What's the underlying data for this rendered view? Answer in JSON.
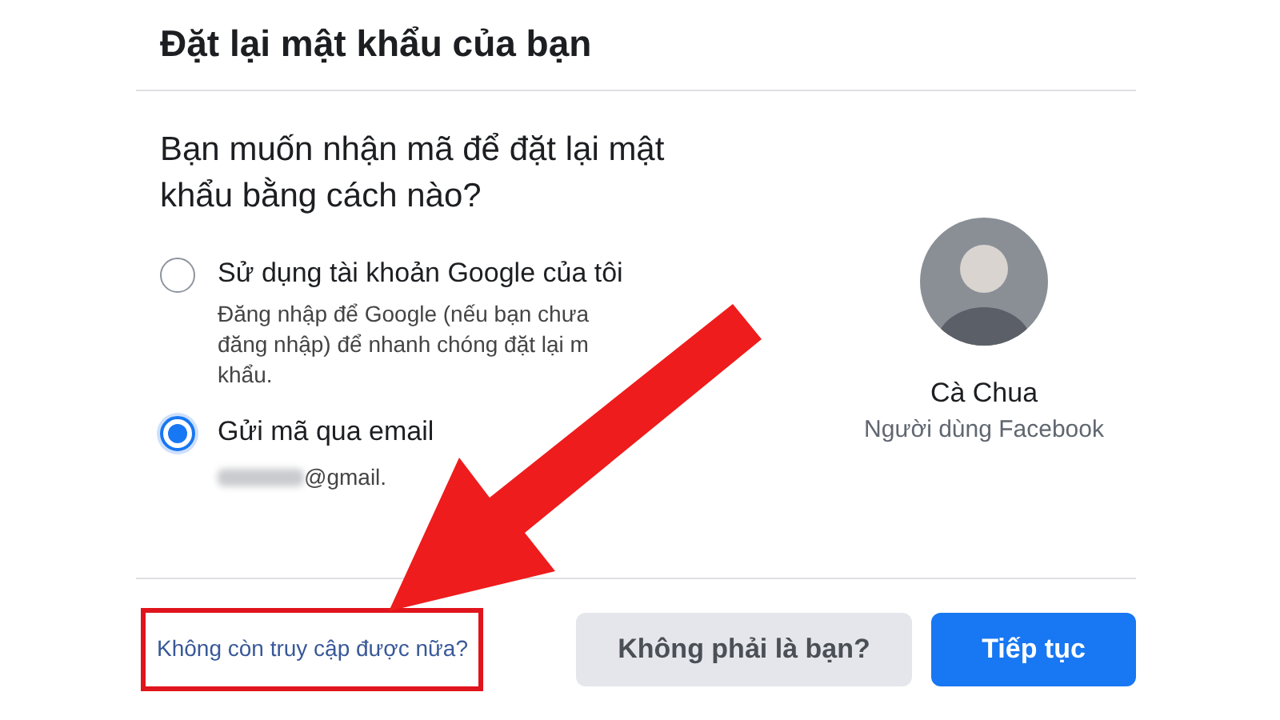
{
  "title": "Đặt lại mật khẩu của bạn",
  "question": "Bạn muốn nhận mã để đặt lại mật khẩu bằng cách nào?",
  "options": [
    {
      "label": "Sử dụng tài khoản Google của tôi",
      "description": [
        "Đăng nhập để Google (nếu bạn chưa",
        "đăng nhập) để nhanh chóng đặt lại m",
        "khẩu."
      ],
      "selected": false
    },
    {
      "label": "Gửi mã qua email",
      "email": "@gmail.",
      "selected": true
    }
  ],
  "profile": {
    "name": "Cà Chua",
    "subtitle": "Người dùng Facebook"
  },
  "footer": {
    "link": "Không còn truy cập được nữa?",
    "highlighted": true,
    "buttons": [
      {
        "label": "Không phải là bạn?",
        "kind": "secondary"
      },
      {
        "label": "Tiếp tục",
        "kind": "primary"
      }
    ]
  }
}
